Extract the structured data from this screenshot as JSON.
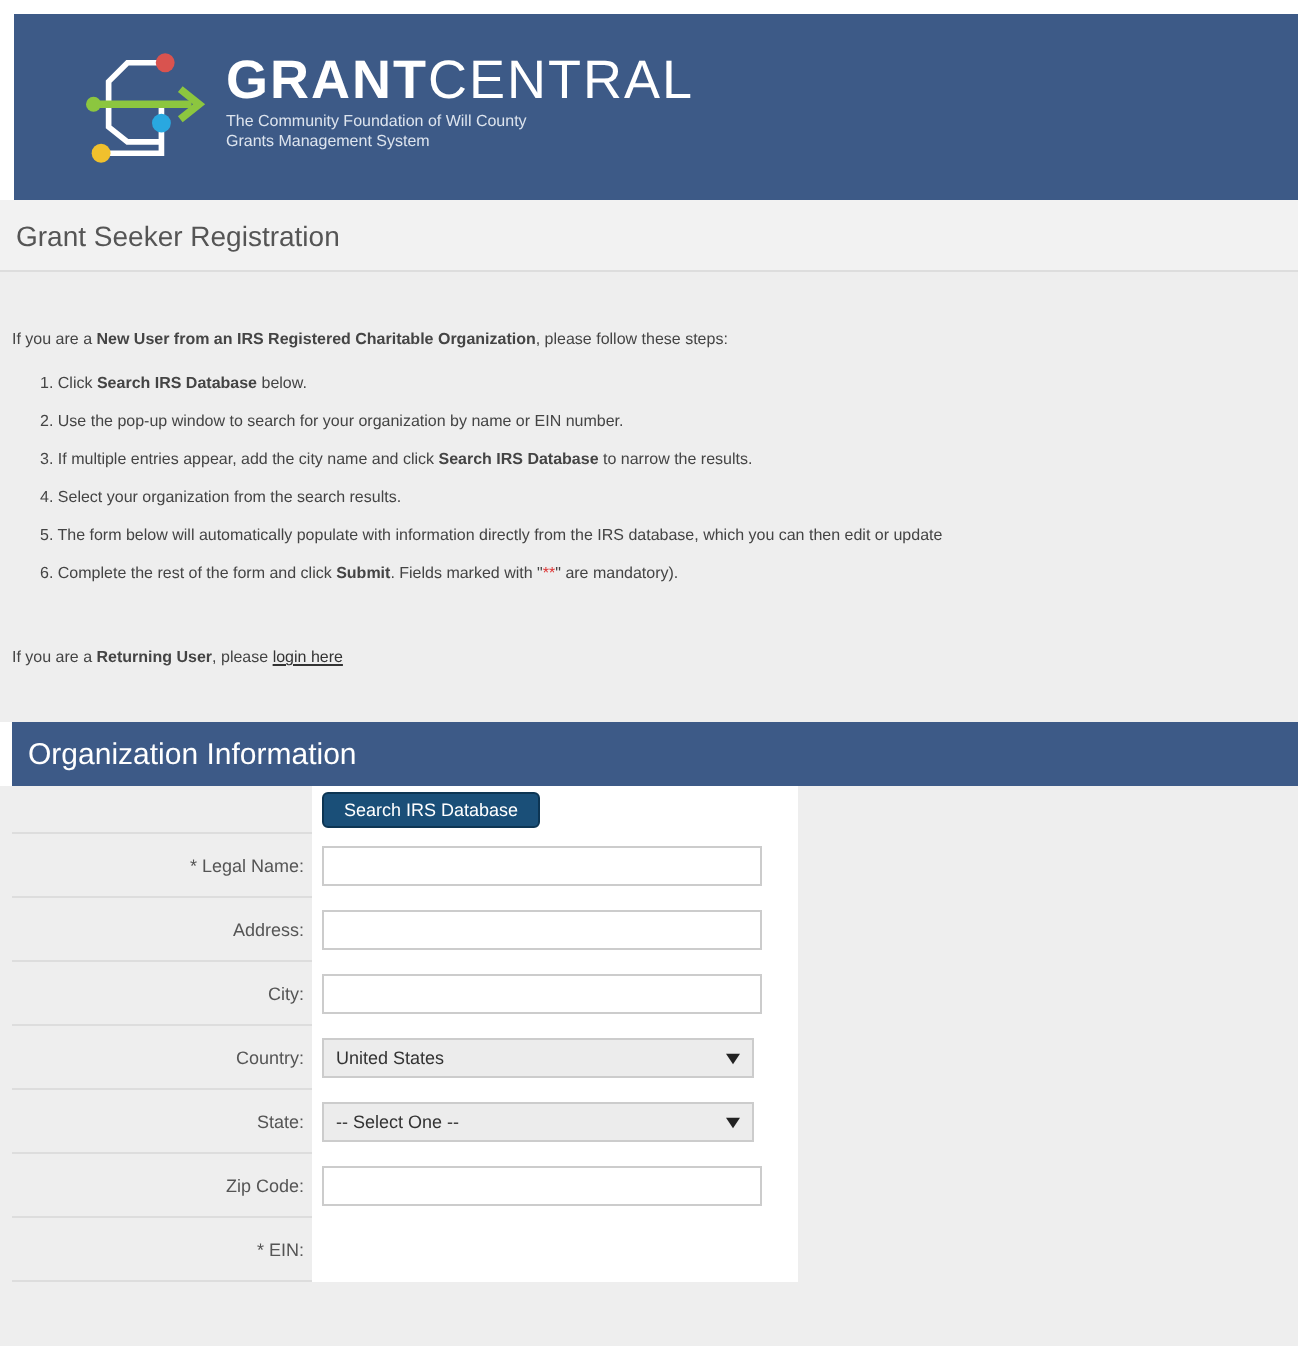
{
  "header": {
    "brand_bold": "GRANT",
    "brand_light": "CENTRAL",
    "tagline": [
      "The Community Foundation of Will County",
      "Grants Management System"
    ]
  },
  "page_title": "Grant Seeker Registration",
  "intro": "If you are a **New User from an IRS Registered Charitable Organization**, please follow these steps:",
  "steps": [
    {
      "number": "1.",
      "text": "Click **Search IRS Database** below."
    },
    {
      "number": "2.",
      "text": "Use the pop-up window to search for your organization by name or EIN number."
    },
    {
      "number": "3.",
      "text": "If multiple entries appear, add the city name and click **Search IRS Database** to narrow the results."
    },
    {
      "number": "4.",
      "text": "Select your organization from the search results."
    },
    {
      "number": "5.",
      "text": "The form below will automatically populate with information directly from the IRS database, which you can then edit or update"
    },
    {
      "number": "6.",
      "text": "Complete the rest of the form and click **Submit**. Fields marked with \"",
      "required_mark": "**",
      "text_after": "\" are mandatory)."
    }
  ],
  "returning": {
    "text": "If you are a **Returning User**, please",
    "link": "login here"
  },
  "section_title": "Organization Information",
  "search_button": "Search IRS Database",
  "fields": [
    {
      "label": "* Legal Name:",
      "kind": "text"
    },
    {
      "label": "Address:",
      "kind": "text"
    },
    {
      "label": "City:",
      "kind": "text"
    },
    {
      "label": "Country:",
      "kind": "select",
      "value": "United States"
    },
    {
      "label": "State:",
      "kind": "select",
      "value": "-- Select One --"
    },
    {
      "label": "Zip Code:",
      "kind": "text"
    },
    {
      "label": "* EIN:",
      "kind": "none"
    }
  ]
}
